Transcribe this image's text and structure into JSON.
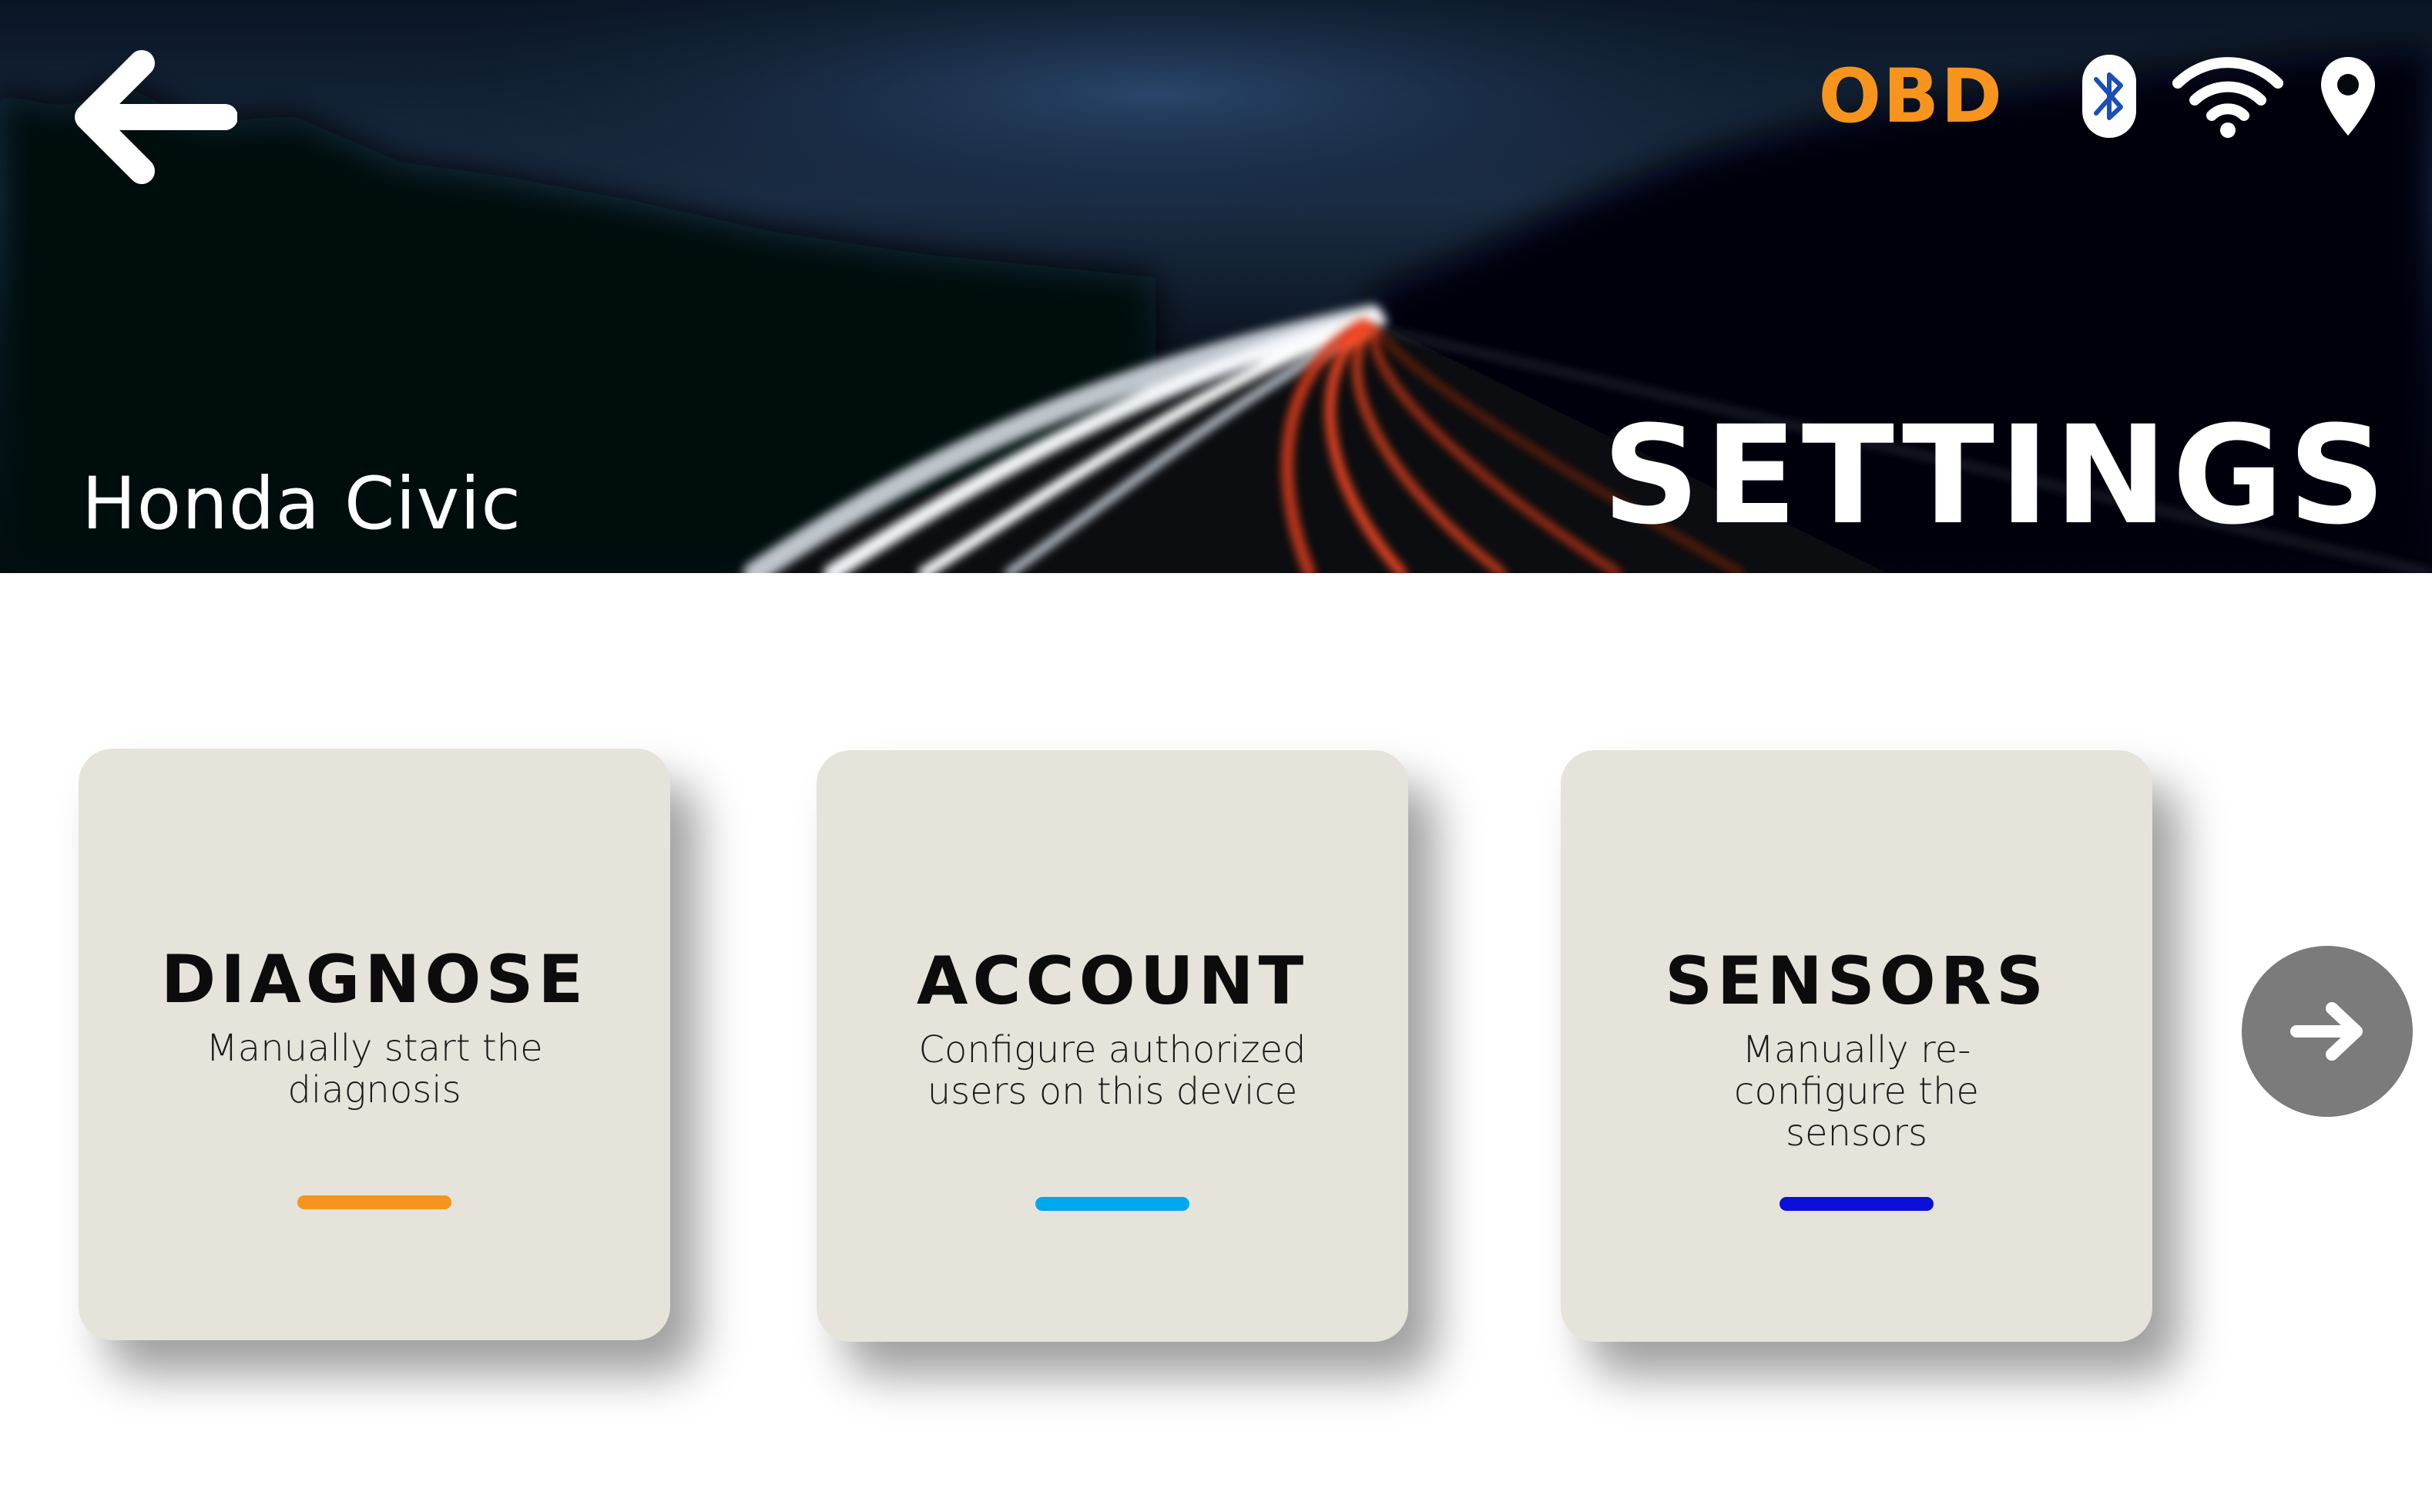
{
  "header": {
    "vehicle_name": "Honda Civic",
    "page_title": "SETTINGS",
    "back_icon": "back-arrow-icon",
    "status": {
      "obd_label": "OBD",
      "obd_color": "#f7941d",
      "icons": [
        "bluetooth-icon",
        "wifi-icon",
        "location-pin-icon"
      ],
      "bluetooth_color": "#1a4fb5"
    }
  },
  "cards": [
    {
      "title": "DIAGNOSE",
      "description": "Manually start the diagnosis",
      "accent_color": "#f7941d"
    },
    {
      "title": "ACCOUNT",
      "description": "Configure authorized users on this device",
      "accent_color": "#00a8ee"
    },
    {
      "title": "SENSORS",
      "description": "Manually re-configure the sensors",
      "accent_color": "#0b10d8"
    }
  ],
  "navigation": {
    "next_icon": "next-arrow-icon"
  },
  "colors": {
    "card_background": "#e5e3da",
    "next_button": "#7b7b7b",
    "header_background": "#05080d"
  }
}
